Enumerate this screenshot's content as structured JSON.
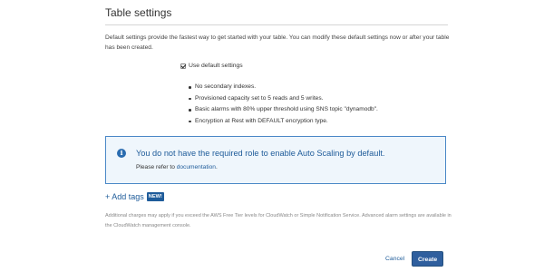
{
  "section": {
    "title": "Table settings",
    "intro": "Default settings provide the fastest way to get started with your table. You can modify these default settings now or after your table has been created."
  },
  "defaults": {
    "checkbox_label": "Use default settings",
    "checked": true,
    "items": [
      "No secondary indexes.",
      "Provisioned capacity set to 5 reads and 5 writes.",
      "Basic alarms with 80% upper threshold using SNS topic \"dynamodb\".",
      "Encryption at Rest with DEFAULT encryption type."
    ]
  },
  "notice": {
    "icon": "info-icon",
    "title": "You do not have the required role to enable Auto Scaling by default.",
    "body_prefix": "Please refer to ",
    "link_text": "documentation",
    "body_suffix": "."
  },
  "tags": {
    "label": "+ Add tags",
    "badge": "NEW!"
  },
  "footnote": "Additional charges may apply if you exceed the AWS Free Tier levels for CloudWatch or Simple Notification Service. Advanced alarm settings are available in the CloudWatch management console.",
  "actions": {
    "cancel_label": "Cancel",
    "create_label": "Create"
  },
  "colors": {
    "accent": "#1f5c9a",
    "primary_button": "#2f5f9e",
    "notice_border": "#4a88c7",
    "notice_background": "#eff6fc"
  }
}
